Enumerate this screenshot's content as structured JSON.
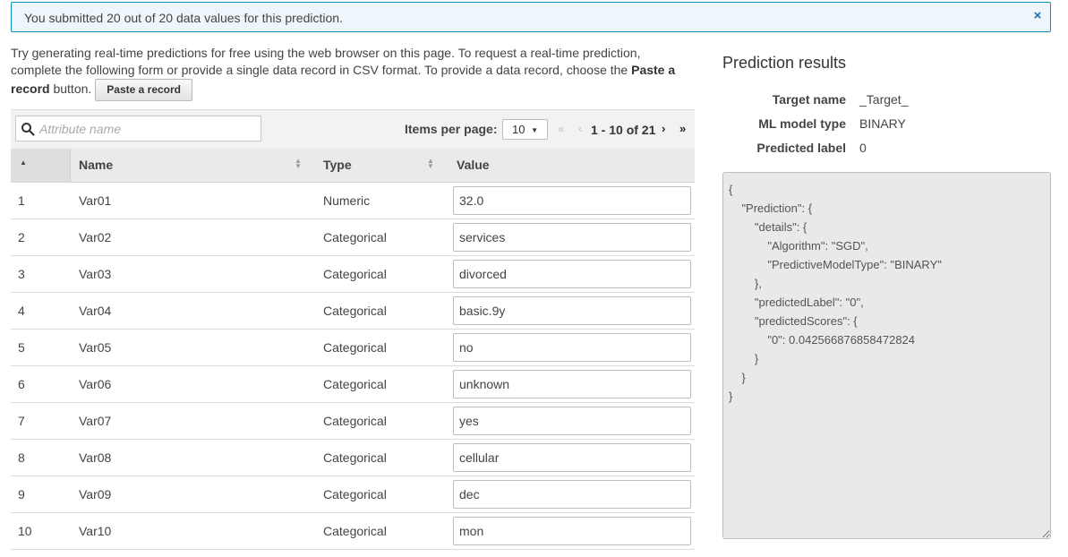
{
  "banner": {
    "message": "You submitted 20 out of 20 data values for this prediction.",
    "close_glyph": "×"
  },
  "intro": {
    "text_1": "Try generating real-time predictions for free using the web browser on this page. To request a real-time prediction, complete the following form or provide a single data record in CSV format. To provide a data record, choose the ",
    "bold": "Paste a record",
    "text_2": " button.",
    "paste_button": "Paste a record"
  },
  "toolbar": {
    "search_placeholder": "Attribute name",
    "items_per_page_label": "Items per page:",
    "items_per_page_value": "10",
    "range": "1 - 10 of 21",
    "first_glyph": "«",
    "prev_glyph": "‹",
    "next_glyph": "›",
    "last_glyph": "»"
  },
  "table": {
    "columns": {
      "name": "Name",
      "type": "Type",
      "value": "Value"
    },
    "rows": [
      {
        "index": "1",
        "name": "Var01",
        "type": "Numeric",
        "value": "32.0"
      },
      {
        "index": "2",
        "name": "Var02",
        "type": "Categorical",
        "value": "services"
      },
      {
        "index": "3",
        "name": "Var03",
        "type": "Categorical",
        "value": "divorced"
      },
      {
        "index": "4",
        "name": "Var04",
        "type": "Categorical",
        "value": "basic.9y"
      },
      {
        "index": "5",
        "name": "Var05",
        "type": "Categorical",
        "value": "no"
      },
      {
        "index": "6",
        "name": "Var06",
        "type": "Categorical",
        "value": "unknown"
      },
      {
        "index": "7",
        "name": "Var07",
        "type": "Categorical",
        "value": "yes"
      },
      {
        "index": "8",
        "name": "Var08",
        "type": "Categorical",
        "value": "cellular"
      },
      {
        "index": "9",
        "name": "Var09",
        "type": "Categorical",
        "value": "dec"
      },
      {
        "index": "10",
        "name": "Var10",
        "type": "Categorical",
        "value": "mon"
      }
    ]
  },
  "results": {
    "title": "Prediction results",
    "target_name_label": "Target name",
    "target_name_value": "_Target_",
    "model_type_label": "ML model type",
    "model_type_value": "BINARY",
    "predicted_label_label": "Predicted label",
    "predicted_label_value": "0",
    "json": "{\n    \"Prediction\": {\n        \"details\": {\n            \"Algorithm\": \"SGD\",\n            \"PredictiveModelType\": \"BINARY\"\n        },\n        \"predictedLabel\": \"0\",\n        \"predictedScores\": {\n            \"0\": 0.042566876858472824\n        }\n    }\n}"
  },
  "colors": {
    "banner_border": "#0a8fb8",
    "banner_bg": "#eef6fb",
    "link_blue": "#1a6fb0"
  }
}
